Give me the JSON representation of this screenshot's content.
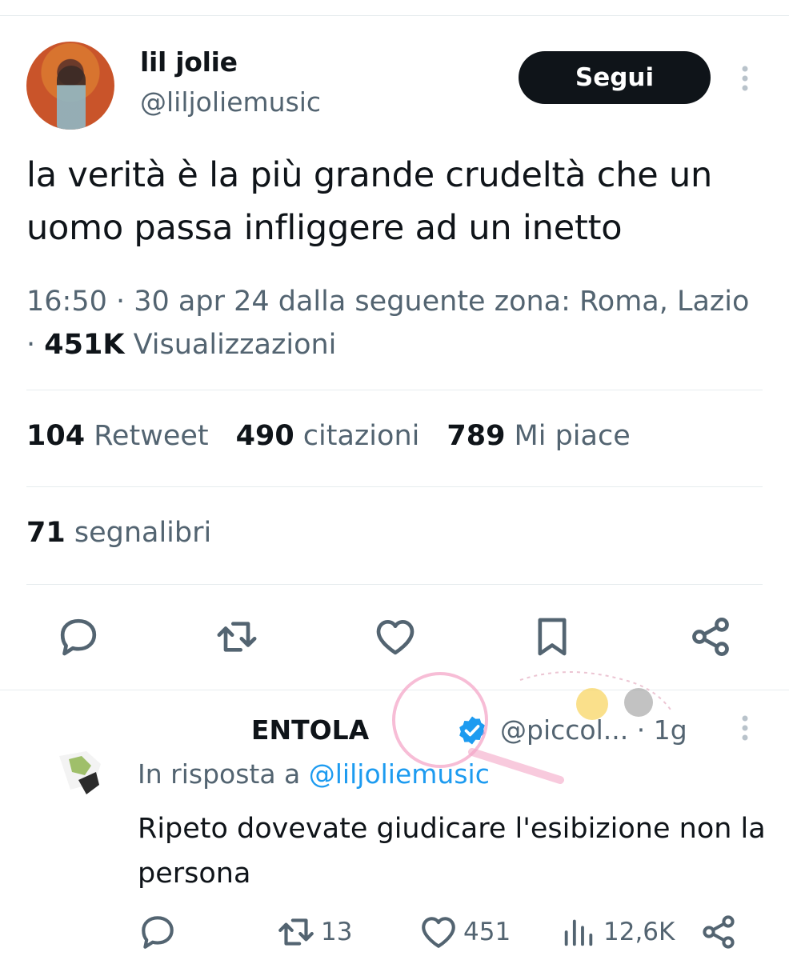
{
  "tweet": {
    "author_name": "lil jolie",
    "author_handle": "@liljoliemusic",
    "follow_label": "Segui",
    "text": "la verità è la più grande crudeltà che un uomo passa infliggere ad un inetto",
    "meta_prefix": "16:50 · 30 apr 24 dalla seguente zona: Roma, Lazio · ",
    "views_count": "451K",
    "views_label": " Visualizzazioni",
    "retweets_count": "104",
    "retweets_label": " Retweet",
    "quotes_count": "490",
    "quotes_label": " citazioni",
    "likes_count": "789",
    "likes_label": " Mi piace",
    "bookmarks_count": "71",
    "bookmarks_label": " segnalibri",
    "actions": [
      "reply-icon",
      "retweet-icon",
      "like-icon",
      "bookmark-icon",
      "share-icon"
    ]
  },
  "reply": {
    "author_name": "      ENTOLA",
    "author_handle": "@piccol...",
    "time": "· 1g",
    "in_reply_prefix": "In risposta a ",
    "in_reply_mention": "@liljoliemusic",
    "text": "Ripeto dovevate giudicare l'esibizione non la persona",
    "retweets": "13",
    "likes": "451",
    "views": "12,6K"
  },
  "colors": {
    "text": "#0f1419",
    "secondary": "#536471",
    "link": "#1d9bf0",
    "button_bg": "#0f1419",
    "divider": "#e6ebee"
  }
}
